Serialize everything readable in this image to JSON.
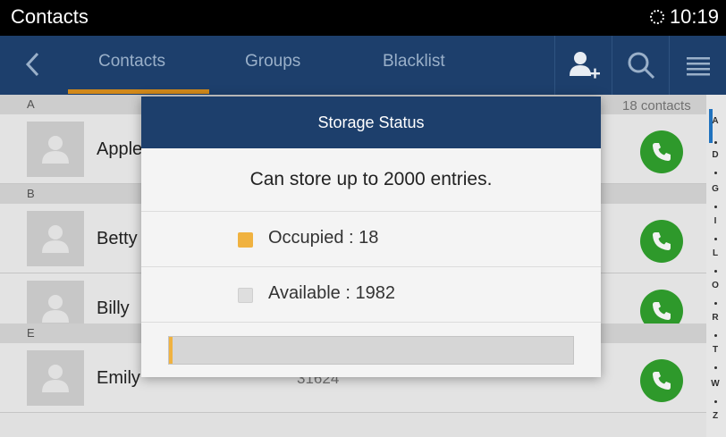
{
  "status_bar": {
    "app_title": "Contacts",
    "time": "10:19"
  },
  "action_bar": {
    "tabs": [
      {
        "label": "Contacts",
        "active": true
      },
      {
        "label": "Groups",
        "active": false
      },
      {
        "label": "Blacklist",
        "active": false
      }
    ],
    "accent_color": "#d2891a",
    "background_color": "#1d3f6c"
  },
  "contacts": {
    "count_label": "18 contacts",
    "sections": [
      {
        "letter": "A",
        "rows": [
          {
            "name": "Apple",
            "number": ""
          }
        ]
      },
      {
        "letter": "B",
        "rows": [
          {
            "name": "Betty",
            "number": ""
          },
          {
            "name": "Billy",
            "number": ""
          }
        ]
      },
      {
        "letter": "E",
        "rows": [
          {
            "name": "Emily",
            "number": "31624"
          }
        ]
      }
    ]
  },
  "index_bar": {
    "letters": [
      "A",
      "D",
      "G",
      "I",
      "L",
      "O",
      "R",
      "T",
      "W",
      "Z"
    ],
    "active": "A"
  },
  "dialog": {
    "title": "Storage Status",
    "message": "Can store up to 2000 entries.",
    "occupied_label": "Occupied : 18",
    "available_label": "Available : 1982",
    "capacity": 2000,
    "occupied": 18,
    "available": 1982,
    "occupied_color": "#f0b240",
    "available_color": "#d6d6d6"
  }
}
